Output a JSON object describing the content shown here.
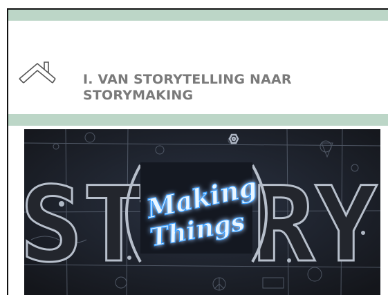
{
  "slide": {
    "title_line1": "I. VAN STORYTELLING NAAR",
    "title_line2": "STORYMAKING",
    "home_icon": "home-outline-icon"
  },
  "image": {
    "left_letters": "ST",
    "right_letters": "RY",
    "neon_line1": "Making",
    "neon_line2": "Things",
    "neon_color": "#3aa0ff",
    "band_color": "#bcd6c7",
    "title_color": "#7a7a7a"
  }
}
